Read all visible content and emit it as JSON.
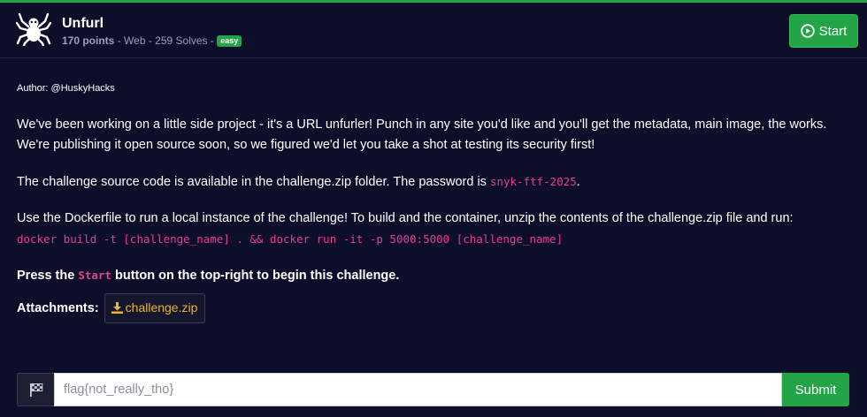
{
  "challenge": {
    "title": "Unfurl",
    "points": "170 points",
    "category": "Web",
    "solves": "259 Solves",
    "difficulty": "easy",
    "separator": " - "
  },
  "header": {
    "start_label": "Start"
  },
  "description": {
    "author": "Author: @HuskyHacks",
    "para1": "We've been working on a little side project - it's a URL unfurler! Punch in any site you'd like and you'll get the metadata, main image, the works. We're publishing it open source soon, so we figured we'd let you take a shot at testing its security first!",
    "para2_before": "The challenge source code is available in the challenge.zip folder. The password is ",
    "para2_password": "snyk-ftf-2025",
    "para2_after": ".",
    "para3": "Use the Dockerfile to run a local instance of the challenge! To build and the container, unzip the contents of the challenge.zip file and run:",
    "command": "docker build -t [challenge_name] . && docker run -it -p 5000:5000 [challenge_name]",
    "press_before": "Press the ",
    "press_code": "Start",
    "press_after": " button on the top-right to begin this challenge."
  },
  "attachments": {
    "label": "Attachments:",
    "file": "challenge.zip"
  },
  "flag_form": {
    "placeholder": "flag{not_really_tho}",
    "submit_label": "Submit"
  },
  "colors": {
    "background": "#0d0f2a",
    "accent_green": "#22a447",
    "code_pink": "#e83e8c",
    "attachment_gold": "#f0b429"
  },
  "icons": {
    "logo": "spider-icon",
    "start": "play-circle-icon",
    "attachment": "download-icon",
    "flag": "flag-checkered-icon"
  }
}
